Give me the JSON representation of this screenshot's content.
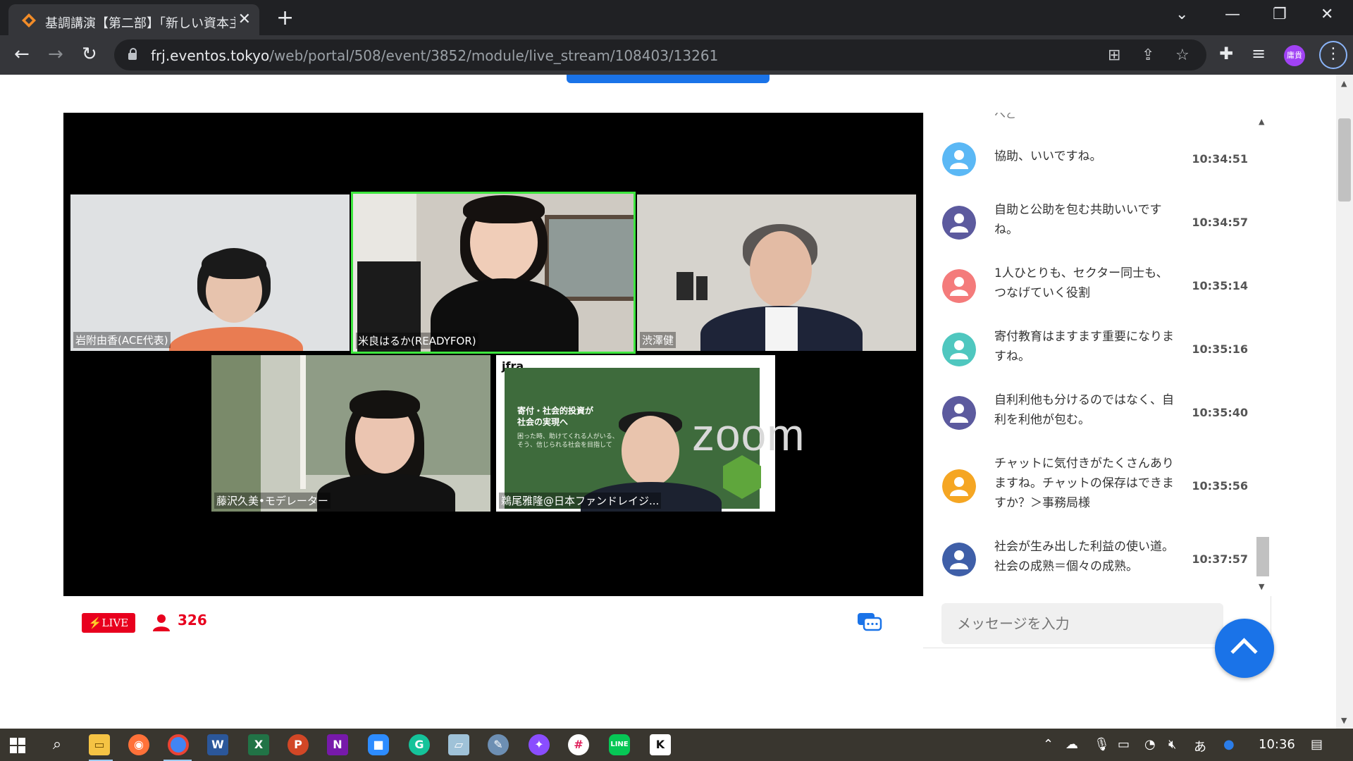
{
  "browser": {
    "tab_title": "基調講演【第二部】「新しい資本主義",
    "url_host": "frj.eventos.tokyo",
    "url_path": "/web/portal/508/event/3852/module/live_stream/108403/13261",
    "profile_initials": "庸貴"
  },
  "video": {
    "participants": [
      {
        "name": "岩附由香(ACE代表)"
      },
      {
        "name": "米良はるか(READYFOR)"
      },
      {
        "name": "渋澤健"
      },
      {
        "name": "藤沢久美•モデレーター"
      },
      {
        "name": "鵜尾雅隆@日本ファンドレイジ..."
      }
    ],
    "slide_brand": "jfra",
    "slide_heading_line1": "寄付・社会的投資が",
    "slide_heading_line2": "社会の実現へ",
    "slide_sub_line1": "困った時、助けてくれる人がいる、",
    "slide_sub_line2": "そう、信じられる社会を目指して",
    "zoom_logo": "zoom"
  },
  "footer": {
    "live_label": "LIVE",
    "viewer_count": "326"
  },
  "chat": {
    "partial_top": "へと",
    "messages": [
      {
        "text": "協助、いいですね。",
        "time": "10:34:51",
        "color": "#5bb8f5"
      },
      {
        "text": "自助と公助を包む共助いいですね。",
        "time": "10:34:57",
        "color": "#5c5a9e"
      },
      {
        "text": "1人ひとりも、セクター同士も、つなげていく役割",
        "time": "10:35:14",
        "color": "#f47b7b"
      },
      {
        "text": "寄付教育はますます重要になりますね。",
        "time": "10:35:16",
        "color": "#4fc7bf"
      },
      {
        "text": "自利利他も分けるのではなく、自利を利他が包む。",
        "time": "10:35:40",
        "color": "#5c5a9e"
      },
      {
        "text": "チャットに気付きがたくさんありますね。チャットの保存はできますか？＞事務局様",
        "time": "10:35:56",
        "color": "#f5a623"
      },
      {
        "text": "社会が生み出した利益の使い道。社会の成熟＝個々の成熟。",
        "time": "10:37:57",
        "color": "#3f5fa8"
      }
    ],
    "input_placeholder": "メッセージを入力"
  },
  "taskbar": {
    "ime": "あ",
    "clock": "10:36"
  }
}
